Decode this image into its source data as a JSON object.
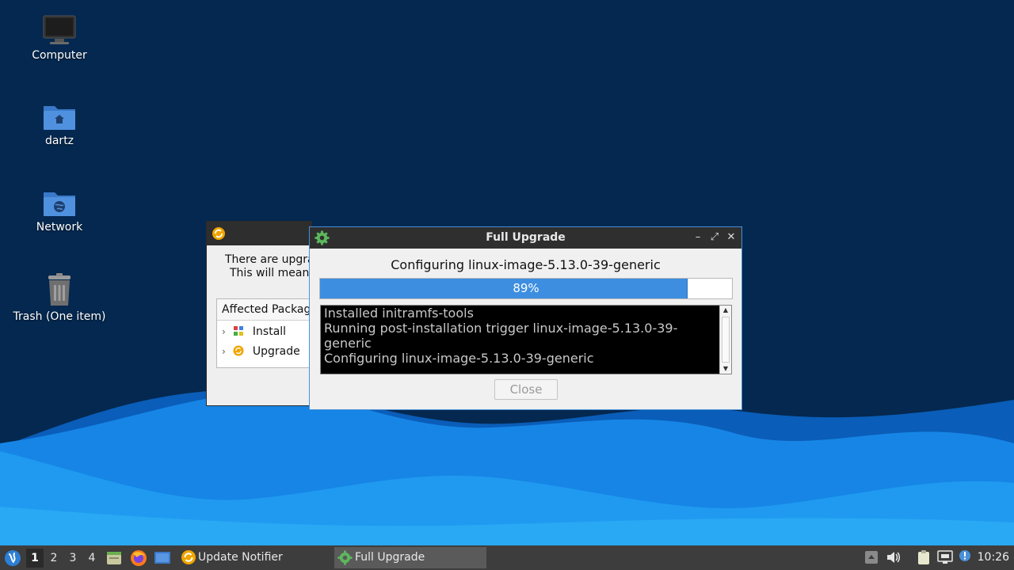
{
  "desktop": {
    "icons": [
      {
        "label": "Computer",
        "icon": "computer-icon"
      },
      {
        "label": "dartz",
        "icon": "home-folder-icon"
      },
      {
        "label": "Network",
        "icon": "network-folder-icon"
      },
      {
        "label": "Trash (One item)",
        "icon": "trash-icon"
      }
    ]
  },
  "background_window": {
    "text_line1": "There are upgra",
    "text_line2": "This will mean",
    "affected_header": "Affected Packag",
    "tree": [
      {
        "label": "Install",
        "icon": "install-icon"
      },
      {
        "label": "Upgrade",
        "icon": "upgrade-icon"
      }
    ]
  },
  "dialog": {
    "title": "Full Upgrade",
    "status": "Configuring linux-image-5.13.0-39-generic",
    "progress": {
      "value": 0.89,
      "label": "89%"
    },
    "log": [
      "Installed initramfs-tools",
      "Running post-installation trigger linux-image-5.13.0-39-generic",
      "Configuring linux-image-5.13.0-39-generic"
    ],
    "close_label": "Close",
    "buttons": {
      "minimize": "–",
      "maximize": "⤢",
      "close": "✕"
    }
  },
  "taskbar": {
    "workspaces": [
      "1",
      "2",
      "3",
      "4"
    ],
    "active_workspace": "1",
    "tasks": [
      {
        "label": "Update Notifier",
        "icon": "update-notifier-icon",
        "active": false
      },
      {
        "label": "Full Upgrade",
        "icon": "gear-icon",
        "active": true
      }
    ],
    "clock": "10:26"
  },
  "colors": {
    "desktop_bg": "#04284f",
    "accent": "#3d8ee0",
    "taskbar": "#3d3d3d"
  }
}
